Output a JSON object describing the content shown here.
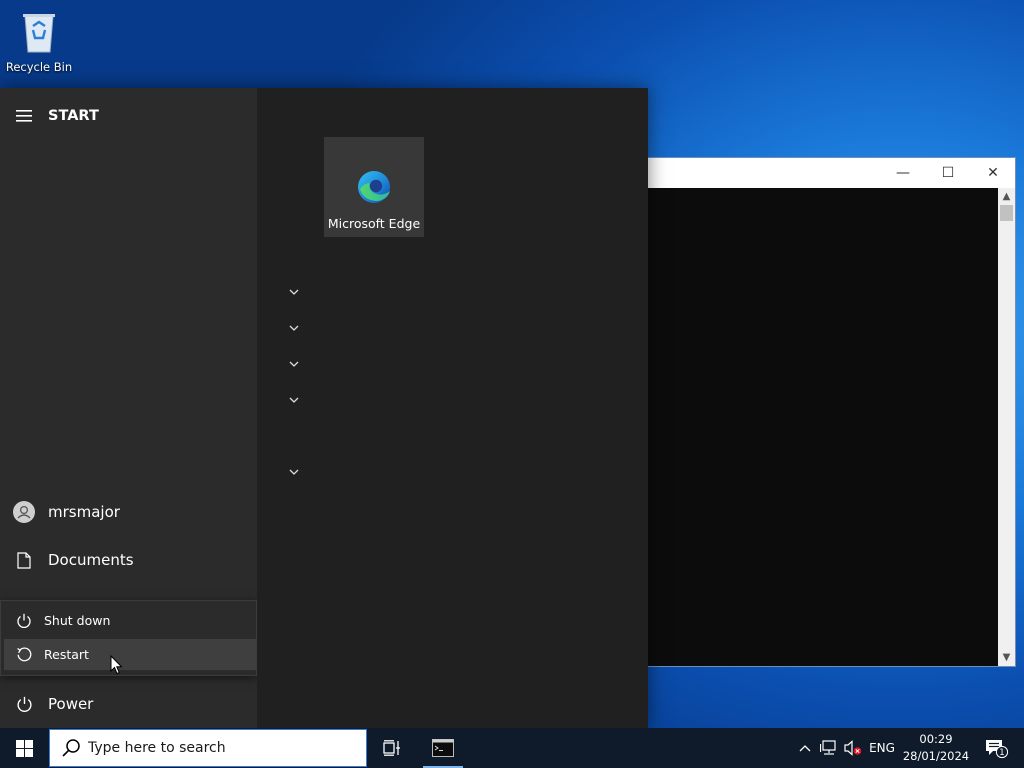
{
  "desktop": {
    "recycle_bin_label": "Recycle Bin"
  },
  "console_window": {
    "minimize_symbol": "—",
    "maximize_symbol": "☐",
    "close_symbol": "✕"
  },
  "start_menu": {
    "header_label": "START",
    "user_label": "mrsmajor",
    "documents_label": "Documents",
    "power_label": "Power",
    "power_flyout": {
      "shutdown_label": "Shut down",
      "restart_label": "Restart"
    },
    "tiles": [
      {
        "label": "Microsoft Edge",
        "icon": "edge-icon"
      }
    ],
    "group_chevrons": 5
  },
  "taskbar": {
    "search_placeholder": "Type here to search",
    "language": "ENG",
    "time": "00:29",
    "date": "28/01/2024",
    "notification_count": "1",
    "accent_color": "#3a7bd5"
  }
}
